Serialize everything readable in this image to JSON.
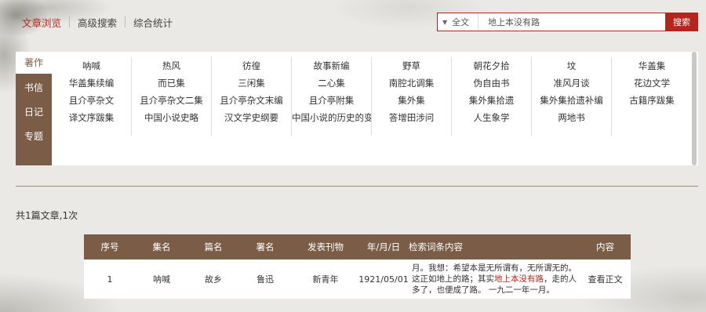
{
  "nav": {
    "items": [
      {
        "label": "文章浏览",
        "active": true
      },
      {
        "label": "高级搜索",
        "active": false
      },
      {
        "label": "综合统计",
        "active": false
      }
    ]
  },
  "search": {
    "scope": "全文",
    "query": "地上本没有路",
    "button": "搜索"
  },
  "side_tabs": [
    "著作",
    "书信",
    "日记",
    "专题"
  ],
  "works_columns": [
    [
      "呐喊",
      "华盖集续编",
      "且介亭杂文",
      "译文序跋集"
    ],
    [
      "热风",
      "而已集",
      "且介亭杂文二集",
      "中国小说史略"
    ],
    [
      "彷徨",
      "三闲集",
      "且介亭杂文末编",
      "汉文学史纲要"
    ],
    [
      "故事新编",
      "二心集",
      "且介亭附集",
      "中国小说的历史的变"
    ],
    [
      "野草",
      "南腔北调集",
      "集外集",
      "答增田涉问"
    ],
    [
      "朝花夕拾",
      "伪自由书",
      "集外集拾遗",
      "人生象学"
    ],
    [
      "坟",
      "准风月谈",
      "集外集拾遗补编",
      "两地书"
    ],
    [
      "华盖集",
      "花边文学",
      "古籍序跋集"
    ]
  ],
  "summary": "共1篇文章,1次",
  "table": {
    "headers": {
      "no": "序号",
      "collection": "集名",
      "title": "篇名",
      "signature": "署名",
      "publication": "发表刊物",
      "date": "年/月/日",
      "context": "检索词条内容",
      "content": "内容"
    },
    "rows": [
      {
        "no": "1",
        "collection": "呐喊",
        "title": "故乡",
        "signature": "鲁迅",
        "publication": "新青年",
        "date": "1921/05/01",
        "context_line1": "月。我想：希望本是无所谓有，无所谓无的。",
        "context_line2_pre": "这正如地上的路；其实",
        "context_highlight": "地上本没有路",
        "context_line2_post": "，走的人",
        "context_line3": "多了，也便成了路。 一九二一年一月。",
        "action": "查看正文"
      }
    ]
  },
  "colors": {
    "accent_red": "#b3261e",
    "brown": "#7b5d47"
  }
}
